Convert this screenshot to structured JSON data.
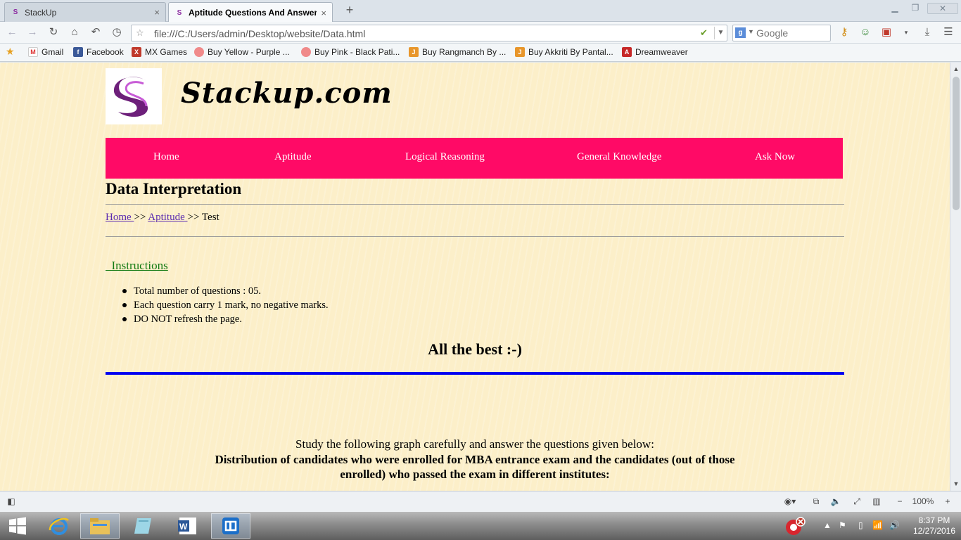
{
  "browser": {
    "tabs": [
      {
        "label": "StackUp",
        "close": "×"
      },
      {
        "label": "Aptitude Questions And Answer...",
        "close": "×"
      }
    ],
    "new_tab": "+",
    "url": "file:///C:/Users/admin/Desktop/website/Data.html",
    "search_placeholder": "Google",
    "bookmarks": [
      "Gmail",
      "Facebook",
      "MX Games",
      "Buy Yellow - Purple ...",
      "Buy Pink - Black Pati...",
      "Buy Rangmanch By ...",
      "Buy Akkriti By Pantal...",
      "Dreamweaver"
    ],
    "zoom": "100%",
    "colors": {
      "nav_pink": "#ff0a66",
      "page_bg": "#fcefc9",
      "link": "#5b2bb0",
      "instructions_green": "#127a12",
      "divider_blue": "#0000f0"
    }
  },
  "page": {
    "site_title": "Stackup.com",
    "nav": [
      "Home",
      "Aptitude",
      "Logical Reasoning",
      "General Knowledge",
      "Ask Now"
    ],
    "heading": "Data Interpretation",
    "breadcrumb": {
      "home": "Home ",
      "sep1": " >> ",
      "aptitude": "Aptitude ",
      "sep2": " >> ",
      "current": "Test"
    },
    "instructions_title": "  Instructions",
    "instructions": [
      "Total number of questions : 05.",
      "Each question carry 1 mark, no negative marks.",
      "DO NOT refresh the page."
    ],
    "all_the_best": "All the best :-)",
    "study_text": "Study the following graph carefully and answer the questions given below:",
    "distribution_text": "Distribution of candidates who were enrolled for MBA entrance exam and the candidates (out of those enrolled) who passed the exam in different institutes:"
  },
  "taskbar": {
    "time": "8:37 PM",
    "date": "12/27/2016"
  }
}
